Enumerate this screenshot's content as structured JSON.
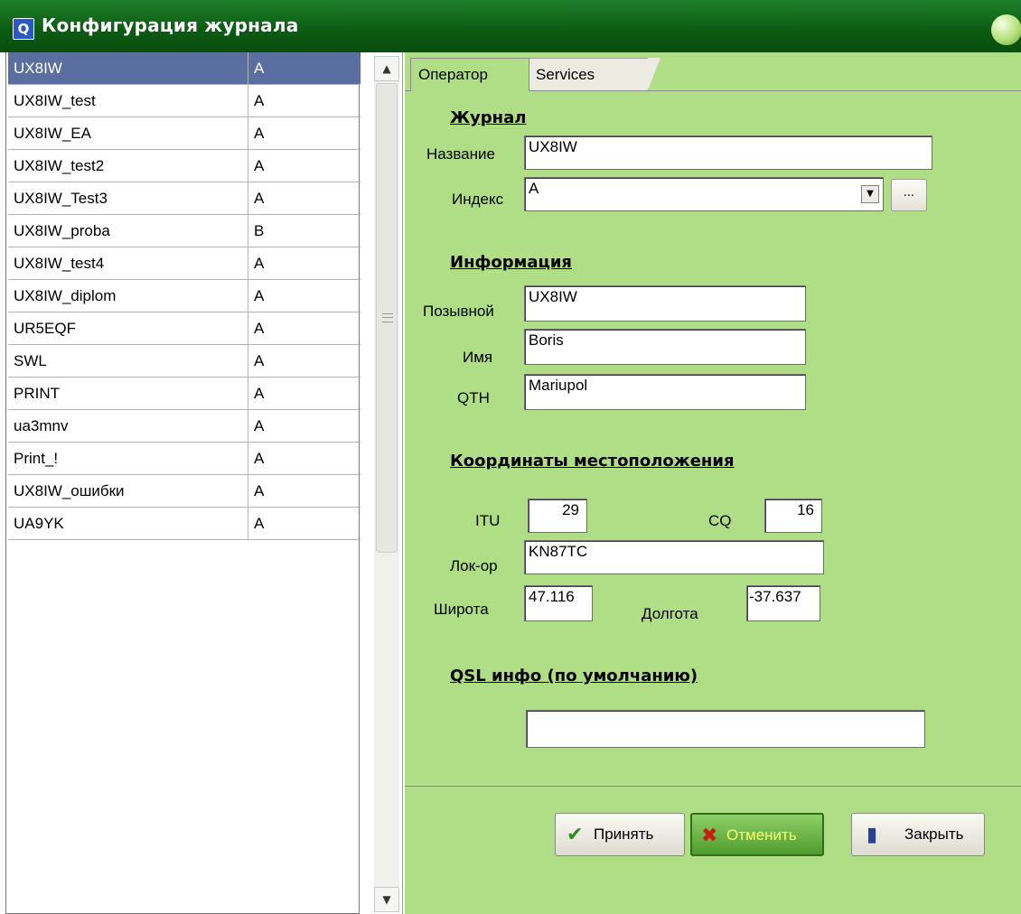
{
  "window": {
    "title": "Конфигурация журнала",
    "icon": "app-log-icon"
  },
  "logs": {
    "rows": [
      {
        "name": "UX8IW",
        "index": "A",
        "selected": true
      },
      {
        "name": "UX8IW_test",
        "index": "A"
      },
      {
        "name": "UX8IW_EA",
        "index": "A"
      },
      {
        "name": "UX8IW_test2",
        "index": "A"
      },
      {
        "name": "UX8IW_Test3",
        "index": "A"
      },
      {
        "name": "UX8IW_proba",
        "index": "B"
      },
      {
        "name": "UX8IW_test4",
        "index": "A"
      },
      {
        "name": "UX8IW_diplom",
        "index": "A"
      },
      {
        "name": "UR5EQF",
        "index": "A"
      },
      {
        "name": "SWL",
        "index": "A"
      },
      {
        "name": "PRINT",
        "index": "A"
      },
      {
        "name": "ua3mnv",
        "index": "A"
      },
      {
        "name": "Print_!",
        "index": "A"
      },
      {
        "name": "UX8IW_ошибки",
        "index": "A"
      },
      {
        "name": "UA9YK",
        "index": "A"
      }
    ]
  },
  "tabs": {
    "operator": "Оператор",
    "services": "Services"
  },
  "journal": {
    "heading": "Журнал",
    "name_label": "Название",
    "name_value": "UX8IW",
    "index_label": "Индекс",
    "index_value": "A",
    "dots_label": "..."
  },
  "info": {
    "heading": "Информация",
    "callsign_label": "Позывной",
    "callsign_value": "UX8IW",
    "firstname_label": "Имя",
    "firstname_value": "Boris",
    "qth_label": "QTH",
    "qth_value": "Mariupol"
  },
  "location": {
    "heading": "Координаты местоположения",
    "itu_label": "ITU",
    "itu_value": "29",
    "cq_label": "CQ",
    "cq_value": "16",
    "locator_label": "Лок-ор",
    "locator_value": "KN87TC",
    "lat_label": "Широта",
    "lat_value": "47.116",
    "lon_label": "Долгота",
    "lon_value": "-37.637"
  },
  "qsl": {
    "heading": "QSL инфо (по умолчанию)",
    "value": ""
  },
  "buttons": {
    "accept": "Принять",
    "cancel": "Отменить",
    "close": "Закрыть"
  },
  "colors": {
    "titlebar": "#0b5a12",
    "panel": "#b0de86",
    "selection": "#5a6fa0",
    "cancel_text": "#ffff66"
  }
}
